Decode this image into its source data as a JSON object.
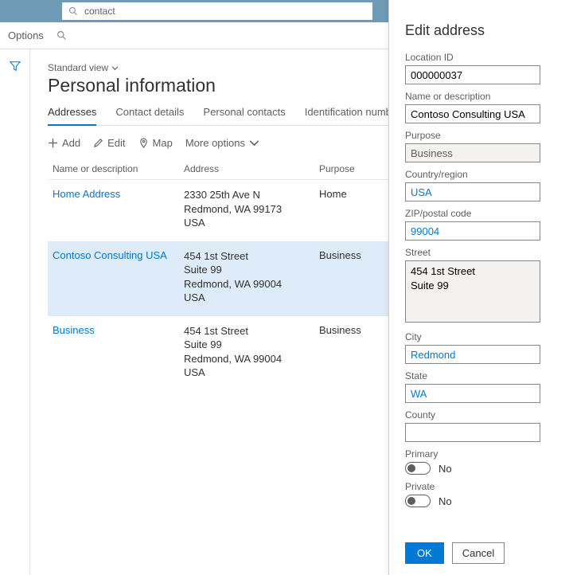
{
  "topbar": {
    "search_value": "contact"
  },
  "options": {
    "label": "Options"
  },
  "main": {
    "view_label": "Standard view",
    "page_title": "Personal information",
    "tabs": [
      "Addresses",
      "Contact details",
      "Personal contacts",
      "Identification numbers"
    ],
    "active_tab": "Addresses",
    "toolbar": {
      "add": "Add",
      "edit": "Edit",
      "map": "Map",
      "more": "More options"
    },
    "columns": {
      "name": "Name or description",
      "address": "Address",
      "purpose": "Purpose"
    },
    "rows": [
      {
        "name": "Home Address",
        "lines": [
          "2330 25th Ave N",
          "Redmond, WA 99173",
          "USA"
        ],
        "purpose": "Home"
      },
      {
        "name": "Contoso Consulting USA",
        "lines": [
          "454 1st Street",
          "Suite 99",
          "Redmond, WA 99004",
          "USA"
        ],
        "purpose": "Business",
        "selected": true
      },
      {
        "name": "Business",
        "lines": [
          "454 1st Street",
          "Suite 99",
          "Redmond, WA 99004",
          "USA"
        ],
        "purpose": "Business"
      }
    ]
  },
  "panel": {
    "title": "Edit address",
    "labels": {
      "location_id": "Location ID",
      "name": "Name or description",
      "purpose": "Purpose",
      "country": "Country/region",
      "zip": "ZIP/postal code",
      "street": "Street",
      "city": "City",
      "state": "State",
      "county": "County",
      "primary": "Primary",
      "private": "Private"
    },
    "values": {
      "location_id": "000000037",
      "name": "Contoso Consulting USA",
      "purpose": "Business",
      "country": "USA",
      "zip": "99004",
      "street": "454 1st Street\nSuite 99",
      "city": "Redmond",
      "state": "WA",
      "county": "",
      "primary": "No",
      "private": "No"
    },
    "actions": {
      "ok": "OK",
      "cancel": "Cancel"
    }
  }
}
